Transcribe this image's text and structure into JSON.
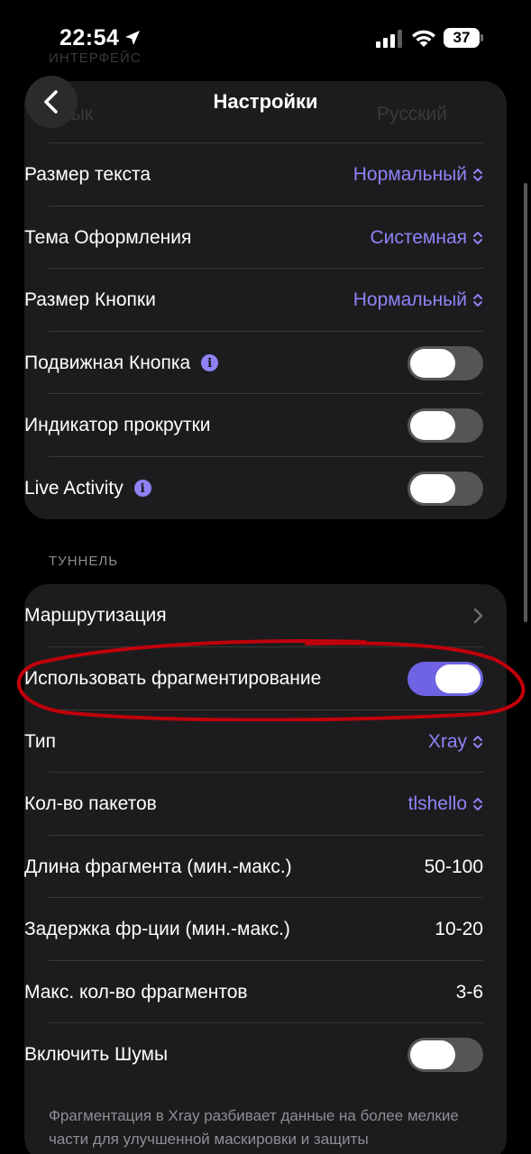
{
  "status_bar": {
    "time": "22:54",
    "battery": "37"
  },
  "ghost": {
    "section": "ИНТЕРФЕЙС",
    "language_label": "Язык",
    "language_value": "Русский"
  },
  "nav": {
    "title": "Настройки"
  },
  "interface_rows": [
    {
      "label": "Размер текста",
      "value": "Нормальный"
    },
    {
      "label": "Тема Оформления",
      "value": "Системная"
    },
    {
      "label": "Размер Кнопки",
      "value": "Нормальный"
    },
    {
      "label": "Подвижная Кнопка",
      "toggle": false
    },
    {
      "label": "Индикатор прокрутки",
      "toggle": false
    },
    {
      "label": "Live Activity",
      "toggle": false
    }
  ],
  "tunnel": {
    "header": "ТУННЕЛЬ",
    "routing": "Маршрутизация",
    "fragmentation": {
      "label": "Использовать фрагментирование",
      "toggle": true
    },
    "type": {
      "label": "Тип",
      "value": "Xray"
    },
    "packets": {
      "label": "Кол-во пакетов",
      "value": "tlshello"
    },
    "length": {
      "label": "Длина фрагмента (мин.-макс.)",
      "value": "50-100"
    },
    "delay": {
      "label": "Задержка фр-ции (мин.-макс.)",
      "value": "10-20"
    },
    "max": {
      "label": "Макс. кол-во фрагментов",
      "value": "3-6"
    },
    "noise": {
      "label": "Включить Шумы",
      "toggle": false
    }
  },
  "footer": "Фрагментация в Xray разбивает данные на более мелкие части для улучшенной маскировки и защиты",
  "colors": {
    "accent": "#8e83f5",
    "toggle_on": "#6f63e3",
    "annotation": "#c0000b"
  },
  "icons": [
    "location-arrow-icon",
    "signal-icon",
    "wifi-icon",
    "battery-icon",
    "chevron-left-icon",
    "info-icon",
    "chevron-up-down-icon",
    "chevron-right-icon"
  ]
}
